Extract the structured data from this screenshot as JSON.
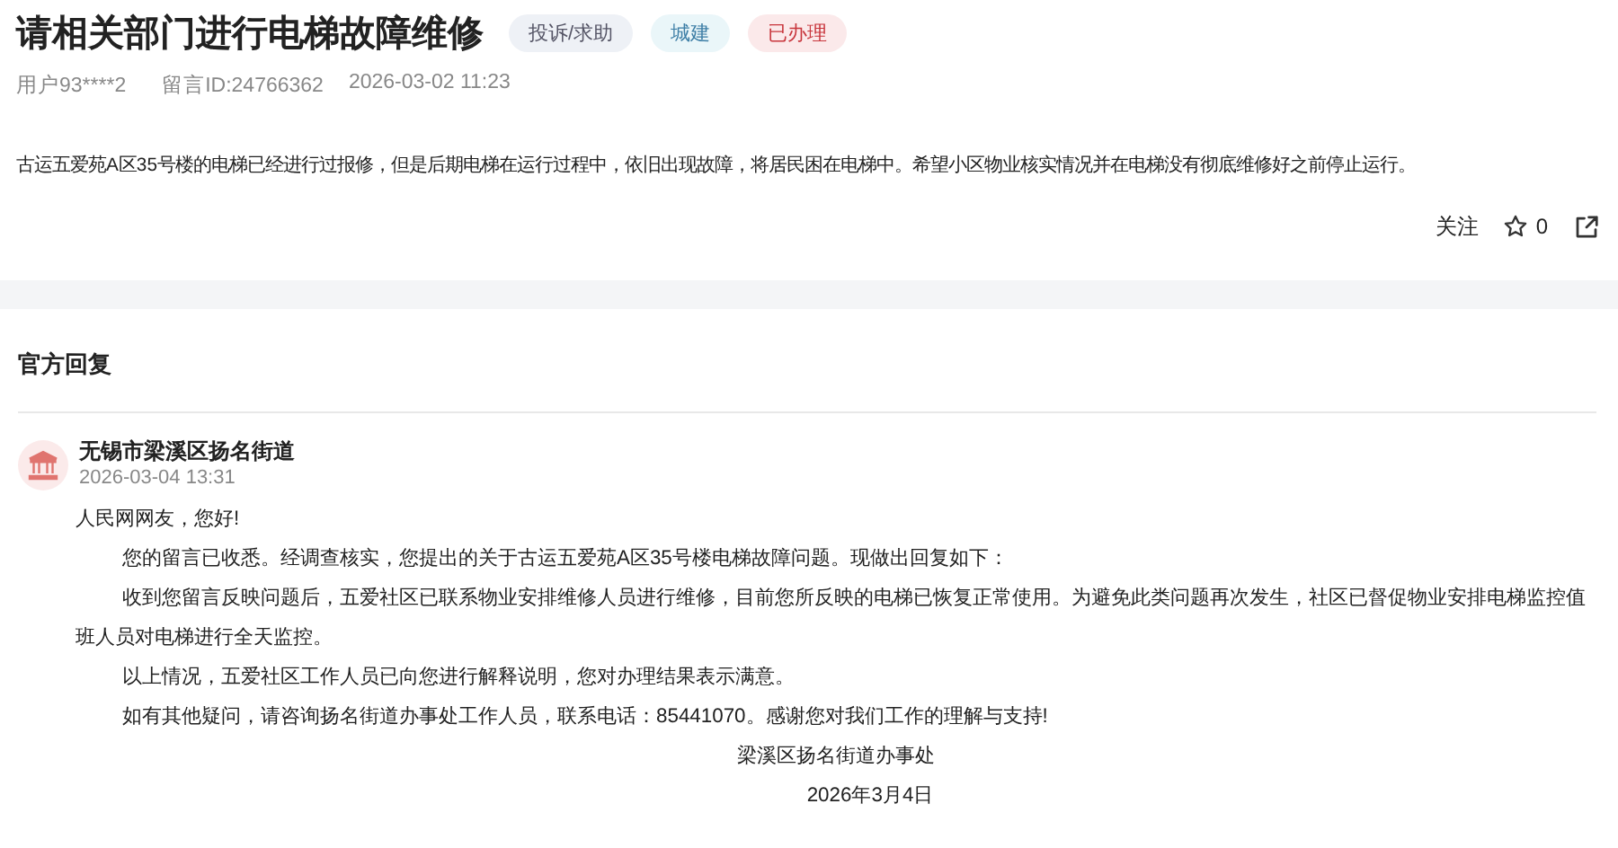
{
  "title": "请相关部门进行电梯故障维修",
  "tags": [
    {
      "label": "投诉/求助",
      "kind": "category"
    },
    {
      "label": "城建",
      "kind": "field"
    },
    {
      "label": "已办理",
      "kind": "status"
    }
  ],
  "meta": {
    "user": "用户93****2",
    "message_id": "留言ID:24766362",
    "time": "2026-03-02 11:23"
  },
  "content": "古运五爱苑A区35号楼的电梯已经进行过报修，但是后期电梯在运行过程中，依旧出现故障，将居民困在电梯中。希望小区物业核实情况并在电梯没有彻底维修好之前停止运行。",
  "actions": {
    "follow": "关注",
    "likes": "0"
  },
  "reply": {
    "heading": "官方回复",
    "department": "无锡市梁溪区扬名街道",
    "time": "2026-03-04 13:31",
    "paragraphs": [
      {
        "kind": "greeting",
        "text": "人民网网友，您好!"
      },
      {
        "kind": "indent",
        "text": "您的留言已收悉。经调查核实，您提出的关于古运五爱苑A区35号楼电梯故障问题。现做出回复如下："
      },
      {
        "kind": "indent",
        "text": "收到您留言反映问题后，五爱社区已联系物业安排维修人员进行维修，目前您所反映的电梯已恢复正常使用。为避免此类问题再次发生，社区已督促物业安排电梯监控值班人员对电梯进行全天监控。"
      },
      {
        "kind": "indent",
        "text": "以上情况，五爱社区工作人员已向您进行解释说明，您对办理结果表示满意。"
      },
      {
        "kind": "indent",
        "text": "如有其他疑问，请咨询扬名街道办事处工作人员，联系电话：85441070。感谢您对我们工作的理解与支持!"
      },
      {
        "kind": "signature",
        "text": "梁溪区扬名街道办事处"
      },
      {
        "kind": "date",
        "text": "2026年3月4日"
      }
    ]
  }
}
